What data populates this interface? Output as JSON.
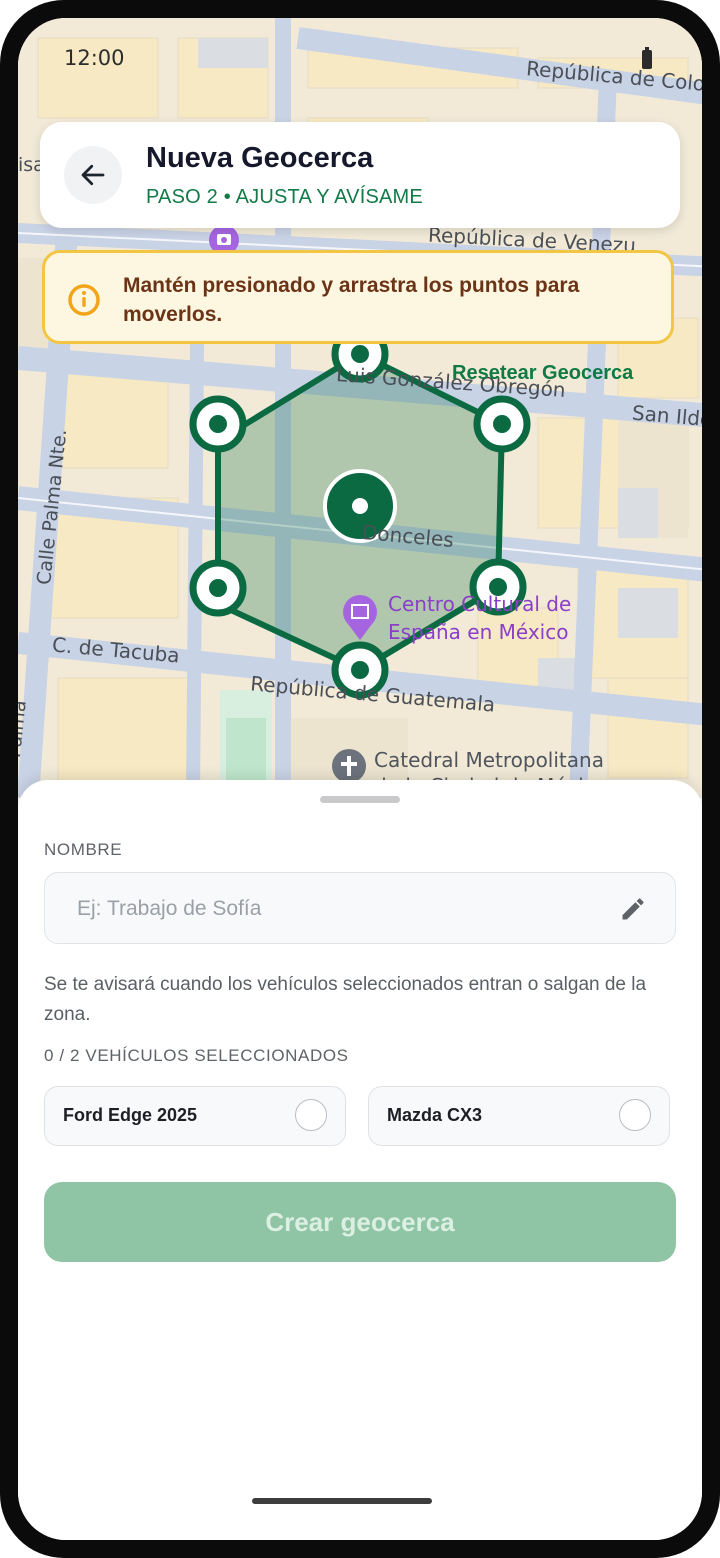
{
  "status_bar": {
    "time": "12:00"
  },
  "header": {
    "title": "Nueva Geocerca",
    "subtitle": "PASO 2 • AJUSTA Y AVÍSAME"
  },
  "hint": {
    "text": "Mantén presionado y arrastra los puntos para moverlos."
  },
  "map": {
    "reset_label": "Resetear Geocerca",
    "streets": [
      "República de Colo",
      "República de Venezu",
      "Luis González Obregón",
      "San Ilde",
      "Calle Palma Nte.",
      "Donceles",
      "C. de Tacuba",
      "República de Guatemala",
      "Palma",
      "isa"
    ],
    "pois": {
      "centro_cultural": [
        "Centro Cultural de",
        "España en México"
      ],
      "catedral": [
        "Catedral Metropolitana",
        "de la Ciudad de México"
      ]
    },
    "colors": {
      "geofence": "#0b6a42",
      "geofence_fill": "#0b6a42"
    }
  },
  "form": {
    "name_label": "NOMBRE",
    "name_placeholder": "Ej: Trabajo de Sofía",
    "name_value": "",
    "description": "Se te avisará cuando los vehículos seleccionados entran o salgan de la zona.",
    "selected_count": "0 / 2 VEHÍCULOS SELECCIONADOS",
    "vehicles": [
      {
        "label": "Ford Edge 2025",
        "selected": false
      },
      {
        "label": "Mazda CX3",
        "selected": false
      }
    ],
    "submit_label": "Crear geocerca"
  },
  "colors": {
    "accent": "#127a46",
    "hint_border": "#f2c543",
    "hint_text": "#6b3416",
    "button_disabled": "#8fc4a4"
  }
}
